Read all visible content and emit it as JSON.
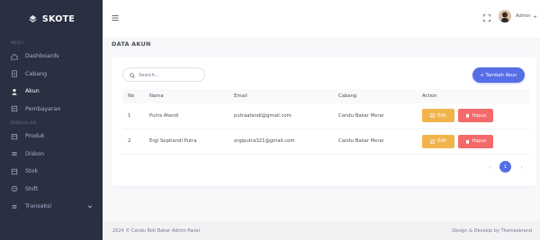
{
  "brand": {
    "name": "SKOTE"
  },
  "sidebar": {
    "sections": [
      {
        "title": "MENU"
      },
      {
        "title": "PENJUALAN"
      }
    ],
    "items": [
      {
        "label": "Dashboards",
        "icon": "home-icon"
      },
      {
        "label": "Cabang",
        "icon": "document-icon"
      },
      {
        "label": "Akun",
        "icon": "user-icon"
      },
      {
        "label": "Pembayaran",
        "icon": "receipt-icon"
      },
      {
        "label": "Produk",
        "icon": "box-icon"
      },
      {
        "label": "Diskon",
        "icon": "tag-icon"
      },
      {
        "label": "Stok",
        "icon": "archive-icon"
      },
      {
        "label": "Shift",
        "icon": "clock-icon"
      },
      {
        "label": "Transaksi",
        "icon": "list-icon"
      }
    ]
  },
  "topbar": {
    "user_name": "Admin"
  },
  "page": {
    "title": "DATA AKUN"
  },
  "search": {
    "placeholder": "Search..."
  },
  "add_button": {
    "label": "+ Tambah Akun"
  },
  "table": {
    "headers": [
      "No",
      "Nama",
      "Email",
      "Cabang",
      "Action"
    ],
    "rows": [
      {
        "no": "1",
        "nama": "Putra Afandi",
        "email": "putraafandi@gmail.com",
        "cabang": "Candu Bakar Merai"
      },
      {
        "no": "2",
        "nama": "Ergi Septiandi Putra",
        "email": "ergiputra321@gmail.com",
        "cabang": "Candu Bakar Merai"
      }
    ],
    "edit_label": "Edit",
    "delete_label": "Hapus"
  },
  "pagination": {
    "current": "1"
  },
  "footer": {
    "left": "2024 © Candu Roti Bakar Admin Panel.",
    "right": "Design & Develop by Themesbrand"
  },
  "colors": {
    "sidebar_bg": "#2a3042",
    "primary": "#556ee6",
    "warning": "#f1b44c",
    "danger": "#f46a6a"
  }
}
